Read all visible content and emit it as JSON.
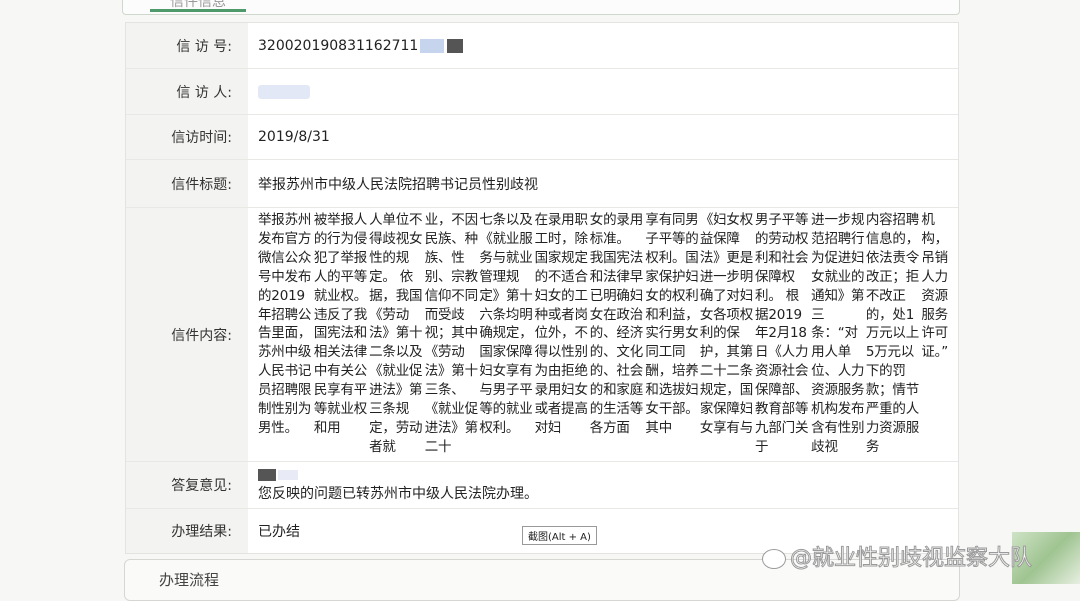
{
  "top_tab": {
    "label": "信件信息"
  },
  "rows": {
    "number": {
      "label": "信  访  号:",
      "value": "32002019083116271​1"
    },
    "person": {
      "label": "信  访  人:"
    },
    "time": {
      "label": "信访时间:",
      "value": "2019/8/31"
    },
    "title": {
      "label": "信件标题:",
      "value": "举报苏州市中级人民法院招聘书记员性别歧视"
    },
    "content": {
      "label": "信件内容:",
      "lines": [
        "举报苏州发布官方微信公众号中发布的2019年招聘公告里面，苏州中级人民书记员招聘限制性别为男性。",
        "被举报人的行为侵犯了举报人的平等就业权。违反了我国宪法和相关法律中有关公民享有平等就业权和用",
        "人单位不得歧视女性的规定。 依据，我国《劳动法》第十二条以及《就业促进法》第三条规定，劳动者就",
        "业，不因民族、种族、性别、宗教信仰不同而受歧视；其中《劳动法》第十三条、《就业促进法》第二十",
        "七条以及《就业服务与就业管理规定》第十六条均明确规定，国家保障妇女享有与男子平等的就业权利。",
        "在录用职工时，除国家规定的不适合妇女的工种或者岗位外，不得以性别为由拒绝录用妇女或者提高对妇",
        "女的录用标准。 我国宪法和法律早已明确妇女在政治的、经济的、文化的、社会的和家庭的生活等各方面",
        "享有同男子平等的权利。国家保护妇女的权利和利益，实行男女同工同酬，培养和选拔妇女干部。 其中",
        "《妇女权益保障法》更是进一步明确了对妇女各项权利的保护，其第二十二条规定，国家保障妇女享有与",
        "男子平等的劳动权利和社会保障权利。 根据2019年2月18日《人力资源社会保障部、教育部等九部门关于",
        "进一步规范招聘行为促进妇女就业的通知》第三条：“对用人单位、人力资源服务机构发布含有性别歧视",
        "内容招聘信息的，依法责令改正；拒不改正的，处1万元以上5万元以下的罚款；情节严重的人力资源服务",
        "机构，吊销人力资源服务许可证。”"
      ]
    },
    "reply": {
      "label": "答复意见:",
      "value": "您反映的问题已转苏州市中级人民法院办理。"
    },
    "result": {
      "label": "办理结果:",
      "value": "已办结"
    }
  },
  "tooltip": {
    "text": "截图(Alt + A)"
  },
  "bottom_panel": {
    "title": "办理流程"
  },
  "watermark": {
    "text": "@就业性别歧视监察大队"
  }
}
